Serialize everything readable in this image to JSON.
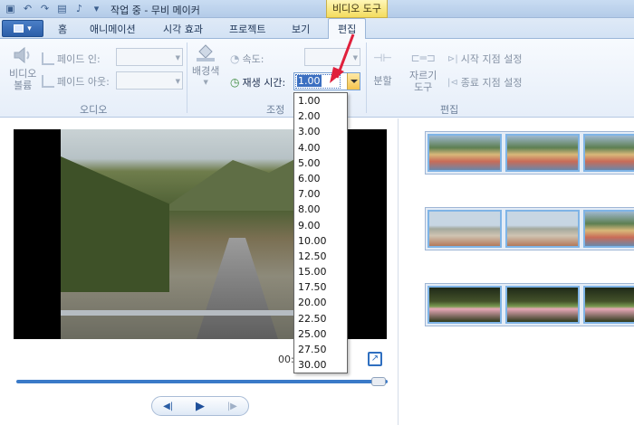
{
  "window": {
    "title": "작업 중 - 무비 메이커",
    "context_group": "비디오 도구"
  },
  "tabs": [
    {
      "label": "홈"
    },
    {
      "label": "애니메이션"
    },
    {
      "label": "시각 효과"
    },
    {
      "label": "프로젝트"
    },
    {
      "label": "보기"
    },
    {
      "label": "편집"
    }
  ],
  "ribbon": {
    "audio": {
      "label": "오디오",
      "video_volume": "비디오\n볼륨",
      "fade_in": "페이드 인:",
      "fade_out": "페이드 아웃:"
    },
    "adjust": {
      "label": "조정",
      "background_color": "배경색",
      "speed": "속도:",
      "duration": "재생 시간:",
      "duration_value": "1.00"
    },
    "edit": {
      "label": "편집",
      "split": "분할",
      "trim_tool": "자르기\n도구",
      "set_start": "시작 지점 설정",
      "set_end": "종료 지점 설정"
    }
  },
  "player": {
    "time": "00:"
  },
  "duration_options": [
    "1.00",
    "2.00",
    "3.00",
    "4.00",
    "5.00",
    "6.00",
    "7.00",
    "8.00",
    "9.00",
    "10.00",
    "12.50",
    "15.00",
    "17.50",
    "20.00",
    "22.50",
    "25.00",
    "27.50",
    "30.00"
  ],
  "colors": {
    "accent": "#3b6fc1",
    "context_tab": "#f4dc5e",
    "arrow": "#e0203c"
  }
}
